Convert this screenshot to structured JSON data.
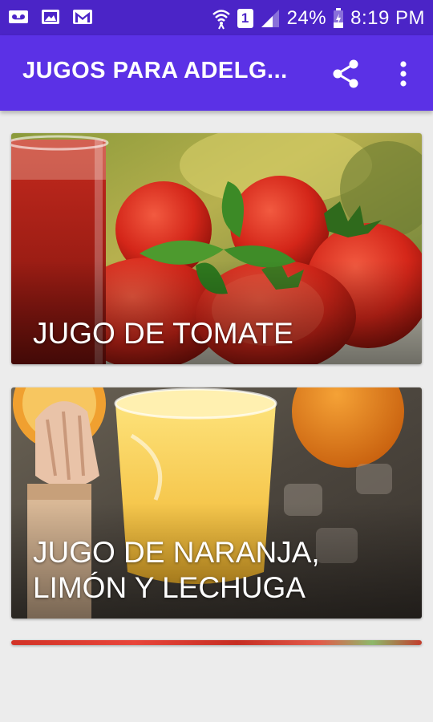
{
  "status_bar": {
    "battery": "24%",
    "time": "8:19 PM",
    "sim_slot": "1",
    "icons": [
      "voicemail-icon",
      "image-icon",
      "gmail-icon",
      "wifi-icon",
      "sim-icon",
      "signal-icon",
      "battery-icon"
    ]
  },
  "app_bar": {
    "title": "JUGOS PARA ADELG...",
    "actions": [
      "share-icon",
      "more-vert-icon"
    ],
    "color": "#5b31e6"
  },
  "cards": [
    {
      "label": "JUGO DE TOMATE"
    },
    {
      "label": "JUGO DE NARANJA, LIMÓN Y LECHUGA"
    }
  ],
  "colors": {
    "status_bar": "#4b24c7",
    "app_bar": "#5b31e6",
    "background": "#ececec"
  }
}
